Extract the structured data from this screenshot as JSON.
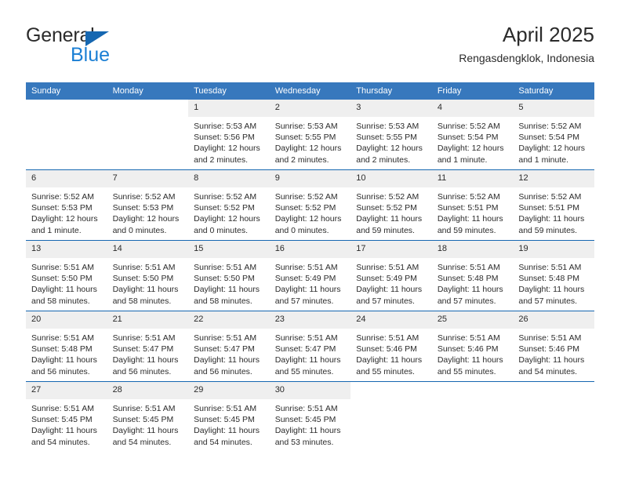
{
  "brand": {
    "line1": "General",
    "line2": "Blue",
    "triangle_color": "#1667b1",
    "blue_color": "#1b7fd4"
  },
  "header": {
    "title": "April 2025",
    "subtitle": "Rengasdengklok, Indonesia"
  },
  "theme": {
    "header_row_bg": "#3778bd",
    "row_divider": "#1667b1",
    "daynum_bg": "#efefef",
    "text": "#2b2b2b"
  },
  "weekdays": [
    "Sunday",
    "Monday",
    "Tuesday",
    "Wednesday",
    "Thursday",
    "Friday",
    "Saturday"
  ],
  "weeks": [
    [
      {
        "day": ""
      },
      {
        "day": ""
      },
      {
        "day": "1",
        "sunrise": "Sunrise: 5:53 AM",
        "sunset": "Sunset: 5:56 PM",
        "daylight": "Daylight: 12 hours and 2 minutes."
      },
      {
        "day": "2",
        "sunrise": "Sunrise: 5:53 AM",
        "sunset": "Sunset: 5:55 PM",
        "daylight": "Daylight: 12 hours and 2 minutes."
      },
      {
        "day": "3",
        "sunrise": "Sunrise: 5:53 AM",
        "sunset": "Sunset: 5:55 PM",
        "daylight": "Daylight: 12 hours and 2 minutes."
      },
      {
        "day": "4",
        "sunrise": "Sunrise: 5:52 AM",
        "sunset": "Sunset: 5:54 PM",
        "daylight": "Daylight: 12 hours and 1 minute."
      },
      {
        "day": "5",
        "sunrise": "Sunrise: 5:52 AM",
        "sunset": "Sunset: 5:54 PM",
        "daylight": "Daylight: 12 hours and 1 minute."
      }
    ],
    [
      {
        "day": "6",
        "sunrise": "Sunrise: 5:52 AM",
        "sunset": "Sunset: 5:53 PM",
        "daylight": "Daylight: 12 hours and 1 minute."
      },
      {
        "day": "7",
        "sunrise": "Sunrise: 5:52 AM",
        "sunset": "Sunset: 5:53 PM",
        "daylight": "Daylight: 12 hours and 0 minutes."
      },
      {
        "day": "8",
        "sunrise": "Sunrise: 5:52 AM",
        "sunset": "Sunset: 5:52 PM",
        "daylight": "Daylight: 12 hours and 0 minutes."
      },
      {
        "day": "9",
        "sunrise": "Sunrise: 5:52 AM",
        "sunset": "Sunset: 5:52 PM",
        "daylight": "Daylight: 12 hours and 0 minutes."
      },
      {
        "day": "10",
        "sunrise": "Sunrise: 5:52 AM",
        "sunset": "Sunset: 5:52 PM",
        "daylight": "Daylight: 11 hours and 59 minutes."
      },
      {
        "day": "11",
        "sunrise": "Sunrise: 5:52 AM",
        "sunset": "Sunset: 5:51 PM",
        "daylight": "Daylight: 11 hours and 59 minutes."
      },
      {
        "day": "12",
        "sunrise": "Sunrise: 5:52 AM",
        "sunset": "Sunset: 5:51 PM",
        "daylight": "Daylight: 11 hours and 59 minutes."
      }
    ],
    [
      {
        "day": "13",
        "sunrise": "Sunrise: 5:51 AM",
        "sunset": "Sunset: 5:50 PM",
        "daylight": "Daylight: 11 hours and 58 minutes."
      },
      {
        "day": "14",
        "sunrise": "Sunrise: 5:51 AM",
        "sunset": "Sunset: 5:50 PM",
        "daylight": "Daylight: 11 hours and 58 minutes."
      },
      {
        "day": "15",
        "sunrise": "Sunrise: 5:51 AM",
        "sunset": "Sunset: 5:50 PM",
        "daylight": "Daylight: 11 hours and 58 minutes."
      },
      {
        "day": "16",
        "sunrise": "Sunrise: 5:51 AM",
        "sunset": "Sunset: 5:49 PM",
        "daylight": "Daylight: 11 hours and 57 minutes."
      },
      {
        "day": "17",
        "sunrise": "Sunrise: 5:51 AM",
        "sunset": "Sunset: 5:49 PM",
        "daylight": "Daylight: 11 hours and 57 minutes."
      },
      {
        "day": "18",
        "sunrise": "Sunrise: 5:51 AM",
        "sunset": "Sunset: 5:48 PM",
        "daylight": "Daylight: 11 hours and 57 minutes."
      },
      {
        "day": "19",
        "sunrise": "Sunrise: 5:51 AM",
        "sunset": "Sunset: 5:48 PM",
        "daylight": "Daylight: 11 hours and 57 minutes."
      }
    ],
    [
      {
        "day": "20",
        "sunrise": "Sunrise: 5:51 AM",
        "sunset": "Sunset: 5:48 PM",
        "daylight": "Daylight: 11 hours and 56 minutes."
      },
      {
        "day": "21",
        "sunrise": "Sunrise: 5:51 AM",
        "sunset": "Sunset: 5:47 PM",
        "daylight": "Daylight: 11 hours and 56 minutes."
      },
      {
        "day": "22",
        "sunrise": "Sunrise: 5:51 AM",
        "sunset": "Sunset: 5:47 PM",
        "daylight": "Daylight: 11 hours and 56 minutes."
      },
      {
        "day": "23",
        "sunrise": "Sunrise: 5:51 AM",
        "sunset": "Sunset: 5:47 PM",
        "daylight": "Daylight: 11 hours and 55 minutes."
      },
      {
        "day": "24",
        "sunrise": "Sunrise: 5:51 AM",
        "sunset": "Sunset: 5:46 PM",
        "daylight": "Daylight: 11 hours and 55 minutes."
      },
      {
        "day": "25",
        "sunrise": "Sunrise: 5:51 AM",
        "sunset": "Sunset: 5:46 PM",
        "daylight": "Daylight: 11 hours and 55 minutes."
      },
      {
        "day": "26",
        "sunrise": "Sunrise: 5:51 AM",
        "sunset": "Sunset: 5:46 PM",
        "daylight": "Daylight: 11 hours and 54 minutes."
      }
    ],
    [
      {
        "day": "27",
        "sunrise": "Sunrise: 5:51 AM",
        "sunset": "Sunset: 5:45 PM",
        "daylight": "Daylight: 11 hours and 54 minutes."
      },
      {
        "day": "28",
        "sunrise": "Sunrise: 5:51 AM",
        "sunset": "Sunset: 5:45 PM",
        "daylight": "Daylight: 11 hours and 54 minutes."
      },
      {
        "day": "29",
        "sunrise": "Sunrise: 5:51 AM",
        "sunset": "Sunset: 5:45 PM",
        "daylight": "Daylight: 11 hours and 54 minutes."
      },
      {
        "day": "30",
        "sunrise": "Sunrise: 5:51 AM",
        "sunset": "Sunset: 5:45 PM",
        "daylight": "Daylight: 11 hours and 53 minutes."
      },
      {
        "day": ""
      },
      {
        "day": ""
      },
      {
        "day": ""
      }
    ]
  ]
}
